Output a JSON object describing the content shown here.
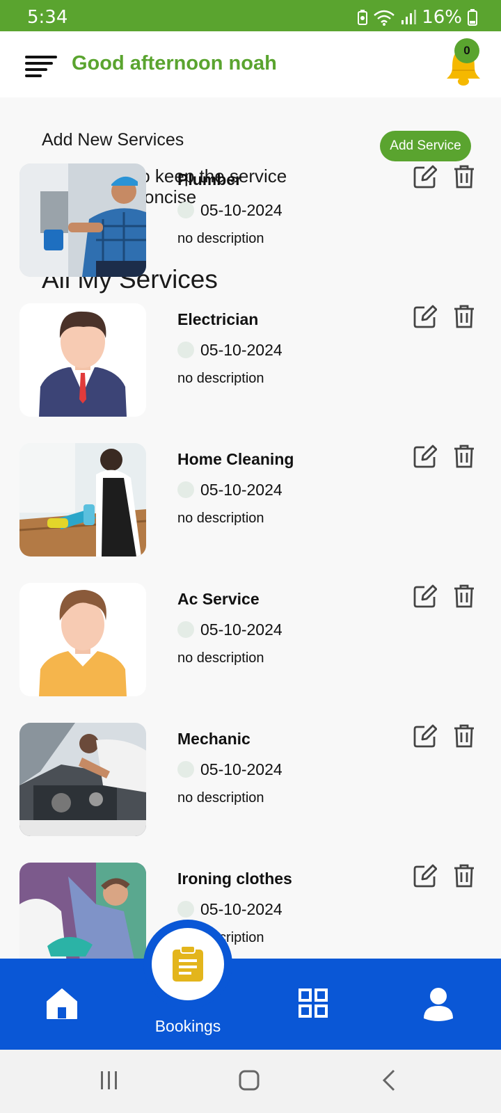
{
  "status_bar": {
    "time": "5:34",
    "battery": "16%",
    "icons": [
      "battery-saver-icon",
      "wifi-icon",
      "signal-icon",
      "battery-icon"
    ]
  },
  "header": {
    "greeting": "Good afternoon noah",
    "notification_count": "0",
    "menu_icon": "menu-icon",
    "bell_icon": "bell-icon"
  },
  "add_section": {
    "title": "Add New Services",
    "description": "to keep the service concise",
    "button_label": "Add Service"
  },
  "all_section": {
    "title": "All My Services"
  },
  "services": [
    {
      "name": "Plumber",
      "date": "05-10-2024",
      "description": "no description",
      "image": "plumber-photo"
    },
    {
      "name": "Electrician",
      "date": "05-10-2024",
      "description": "no description",
      "image": "electrician-avatar"
    },
    {
      "name": "Home Cleaning",
      "date": "05-10-2024",
      "description": "no description",
      "image": "cleaning-photo"
    },
    {
      "name": "Ac Service",
      "date": "05-10-2024",
      "description": "no description",
      "image": "ac-service-avatar"
    },
    {
      "name": "Mechanic",
      "date": "05-10-2024",
      "description": "no description",
      "image": "mechanic-photo"
    },
    {
      "name": "Ironing clothes",
      "date": "05-10-2024",
      "description": "no description",
      "image": "ironing-photo"
    }
  ],
  "bottom_nav": {
    "bookings_label": "Bookings",
    "items": [
      "home-icon",
      "bookings-icon",
      "grid-icon",
      "profile-icon"
    ]
  },
  "colors": {
    "primary_green": "#5aa42f",
    "nav_blue": "#0a57d6",
    "bell_yellow": "#f5b800",
    "fab_icon": "#e3b51c"
  }
}
